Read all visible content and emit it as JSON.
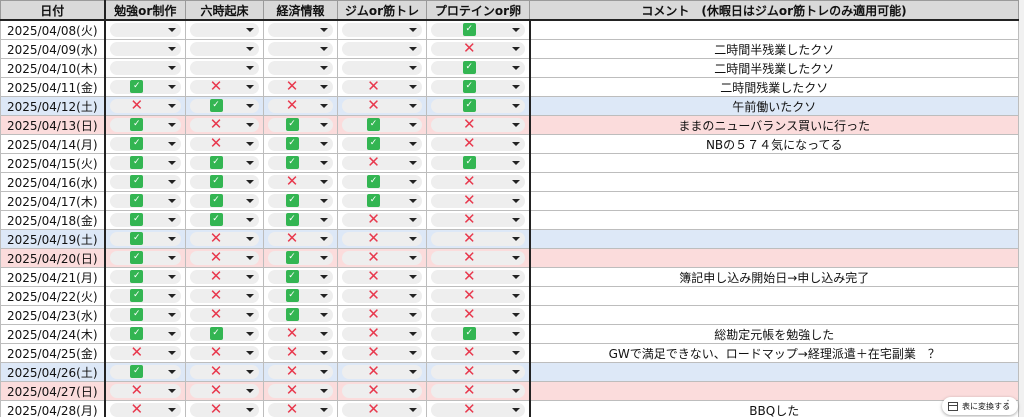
{
  "headers": [
    "日付",
    "勉強or制作",
    "六時起床",
    "経済情報",
    "ジムor筋トレ",
    "プロテインor卵",
    "コメント　(休暇日はジムor筋トレのみ適用可能)"
  ],
  "rows": [
    {
      "date": "2025/04/08(火)",
      "type": "normal",
      "marks": [
        "",
        "",
        "",
        "",
        "ok"
      ],
      "comment": ""
    },
    {
      "date": "2025/04/09(水)",
      "type": "normal",
      "marks": [
        "",
        "",
        "",
        "",
        "ng"
      ],
      "comment": "二時間半残業したクソ"
    },
    {
      "date": "2025/04/10(木)",
      "type": "normal",
      "marks": [
        "",
        "",
        "",
        "",
        "ok"
      ],
      "comment": "二時間半残業したクソ"
    },
    {
      "date": "2025/04/11(金)",
      "type": "normal",
      "marks": [
        "ok",
        "ng",
        "ng",
        "ng",
        "ok"
      ],
      "comment": "二時間残業したクソ"
    },
    {
      "date": "2025/04/12(土)",
      "type": "blue",
      "marks": [
        "ng",
        "ok",
        "ng",
        "ng",
        "ok"
      ],
      "comment": "午前働いたクソ"
    },
    {
      "date": "2025/04/13(日)",
      "type": "pink",
      "marks": [
        "ok",
        "ng",
        "ok",
        "ok",
        "ng"
      ],
      "comment": "ままのニューバランス買いに行った"
    },
    {
      "date": "2025/04/14(月)",
      "type": "normal",
      "marks": [
        "ok",
        "ng",
        "ok",
        "ok",
        "ng"
      ],
      "comment": "NBの５７４気になってる"
    },
    {
      "date": "2025/04/15(火)",
      "type": "normal",
      "marks": [
        "ok",
        "ok",
        "ok",
        "ng",
        "ok"
      ],
      "comment": ""
    },
    {
      "date": "2025/04/16(水)",
      "type": "normal",
      "marks": [
        "ok",
        "ok",
        "ng",
        "ok",
        "ng"
      ],
      "comment": ""
    },
    {
      "date": "2025/04/17(木)",
      "type": "normal",
      "marks": [
        "ok",
        "ok",
        "ok",
        "ok",
        "ng"
      ],
      "comment": ""
    },
    {
      "date": "2025/04/18(金)",
      "type": "normal",
      "marks": [
        "ok",
        "ok",
        "ok",
        "ng",
        "ng"
      ],
      "comment": ""
    },
    {
      "date": "2025/04/19(土)",
      "type": "blue",
      "marks": [
        "ok",
        "ng",
        "ng",
        "ng",
        "ng"
      ],
      "comment": ""
    },
    {
      "date": "2025/04/20(日)",
      "type": "pink",
      "marks": [
        "ok",
        "ng",
        "ok",
        "ng",
        "ng"
      ],
      "comment": ""
    },
    {
      "date": "2025/04/21(月)",
      "type": "normal",
      "marks": [
        "ok",
        "ng",
        "ok",
        "ng",
        "ng"
      ],
      "comment": "簿記申し込み開始日→申し込み完了"
    },
    {
      "date": "2025/04/22(火)",
      "type": "normal",
      "marks": [
        "ok",
        "ng",
        "ok",
        "ng",
        "ng"
      ],
      "comment": ""
    },
    {
      "date": "2025/04/23(水)",
      "type": "normal",
      "marks": [
        "ok",
        "ng",
        "ok",
        "ng",
        "ng"
      ],
      "comment": ""
    },
    {
      "date": "2025/04/24(木)",
      "type": "normal",
      "marks": [
        "ok",
        "ok",
        "ng",
        "ng",
        "ok"
      ],
      "comment": "総勘定元帳を勉強した"
    },
    {
      "date": "2025/04/25(金)",
      "type": "normal",
      "marks": [
        "ng",
        "ng",
        "ng",
        "ng",
        "ng"
      ],
      "comment": "GWで満足できない、ロードマップ→経理派遣＋在宅副業　？"
    },
    {
      "date": "2025/04/26(土)",
      "type": "blue",
      "marks": [
        "ok",
        "ng",
        "ng",
        "ng",
        "ng"
      ],
      "comment": ""
    },
    {
      "date": "2025/04/27(日)",
      "type": "pink",
      "marks": [
        "ng",
        "ng",
        "ng",
        "ng",
        "ng"
      ],
      "comment": ""
    },
    {
      "date": "2025/04/28(月)",
      "type": "normal",
      "marks": [
        "ng",
        "ng",
        "ng",
        "ng",
        "ng"
      ],
      "comment": "BBQした"
    }
  ],
  "floating_pill": {
    "icon": "table-icon",
    "label": "表に変換する",
    "more": "⋮"
  },
  "colors": {
    "header_bg": "#d9d9d9",
    "saturday_bg": "#dde8f7",
    "sunday_bg": "#fbdcdc",
    "ok": "#33b552",
    "ng": "#e8384d",
    "dropdown_bg": "#eeeeee"
  }
}
